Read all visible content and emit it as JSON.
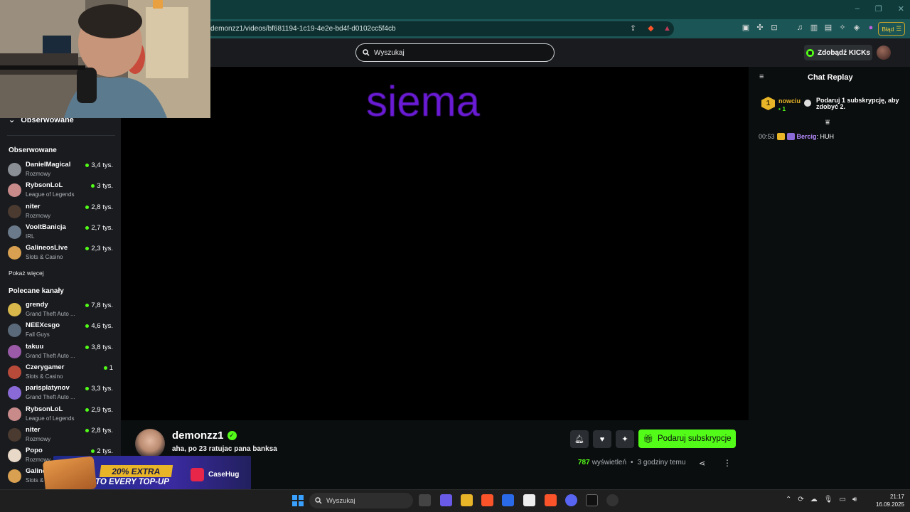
{
  "browser": {
    "url": "demonzz1/videos/bf681194-1c19-4e2e-bd4f-d0102cc5f4cb",
    "error_label": "Błąd",
    "window_controls": [
      "–",
      "❐",
      "✕"
    ],
    "shield_count": "",
    "alert_count": ""
  },
  "header": {
    "search_placeholder": "Wyszukaj",
    "kicks_button": "Zdobądź KICKs"
  },
  "sidebar": {
    "followed_toggle": "Obserwowane",
    "followed_heading": "Obserwowane",
    "followed": [
      {
        "name": "DanielMagical",
        "category": "Rozmowy",
        "viewers": "3,4 tys.",
        "color": "#8a8f96"
      },
      {
        "name": "RybsonLoL",
        "category": "League of Legends",
        "viewers": "3 tys.",
        "color": "#c98a8a"
      },
      {
        "name": "niter",
        "category": "Rozmowy",
        "viewers": "2,8 tys.",
        "color": "#4a3a30"
      },
      {
        "name": "VooltBanicja",
        "category": "IRL",
        "viewers": "2,7 tys.",
        "color": "#6a7a8a"
      },
      {
        "name": "GalineosLive",
        "category": "Slots & Casino",
        "viewers": "2,3 tys.",
        "color": "#d8a050"
      }
    ],
    "show_more": "Pokaż więcej",
    "recommended_heading": "Polecane kanały",
    "recommended": [
      {
        "name": "grendy",
        "category": "Grand Theft Auto ...",
        "viewers": "7,8 tys.",
        "color": "#d8b84a"
      },
      {
        "name": "NEEXcsgo",
        "category": "Fall Guys",
        "viewers": "4,6 tys.",
        "color": "#5a6a7a"
      },
      {
        "name": "takuu",
        "category": "Grand Theft Auto ...",
        "viewers": "3,8 tys.",
        "color": "#9a5aa8"
      },
      {
        "name": "Czerygamer",
        "category": "Slots & Casino",
        "viewers": "1",
        "color": "#b84a3a"
      },
      {
        "name": "parisplatynov",
        "category": "Grand Theft Auto ...",
        "viewers": "3,3 tys.",
        "color": "#8a6ad6"
      },
      {
        "name": "RybsonLoL",
        "category": "League of Legends",
        "viewers": "2,9 tys.",
        "color": "#c98a8a"
      },
      {
        "name": "niter",
        "category": "Rozmowy",
        "viewers": "2,8 tys.",
        "color": "#4a3a30"
      },
      {
        "name": "Popo",
        "category": "Rozmowy",
        "viewers": "2 tys.",
        "color": "#e8d8c8"
      },
      {
        "name": "Galine",
        "category": "Slots &",
        "viewers": "",
        "color": "#d8a050"
      }
    ]
  },
  "video": {
    "overlay_text": "siema"
  },
  "stream": {
    "streamer": "demonzz1",
    "title": "aha, po 23 ratujac pana banksa",
    "gift_button": "Podaruj subskrypcje",
    "views_count": "787",
    "views_label": "wyświetleń",
    "separator": "•",
    "time_ago": "3 godziny temu"
  },
  "ad": {
    "badge": "20% EXTRA",
    "line2": "TO EVERY TOP-UP",
    "brand": "CaseHug"
  },
  "chat": {
    "title": "Chat Replay",
    "pinned": {
      "level": "1",
      "user": "nowciu",
      "count": "1",
      "text": "Podaruj 1 subskrypcję, aby zdobyć 2."
    },
    "messages": [
      {
        "time": "00:53",
        "user": "Bercig",
        "text": ": HUH"
      }
    ]
  },
  "taskbar": {
    "search_placeholder": "Wyszukaj",
    "time": "21:17",
    "date": "16.09.2025"
  },
  "colors": {
    "accent": "#53fc18",
    "purple_text": "#6a1bd6",
    "gold": "#e8b428"
  }
}
